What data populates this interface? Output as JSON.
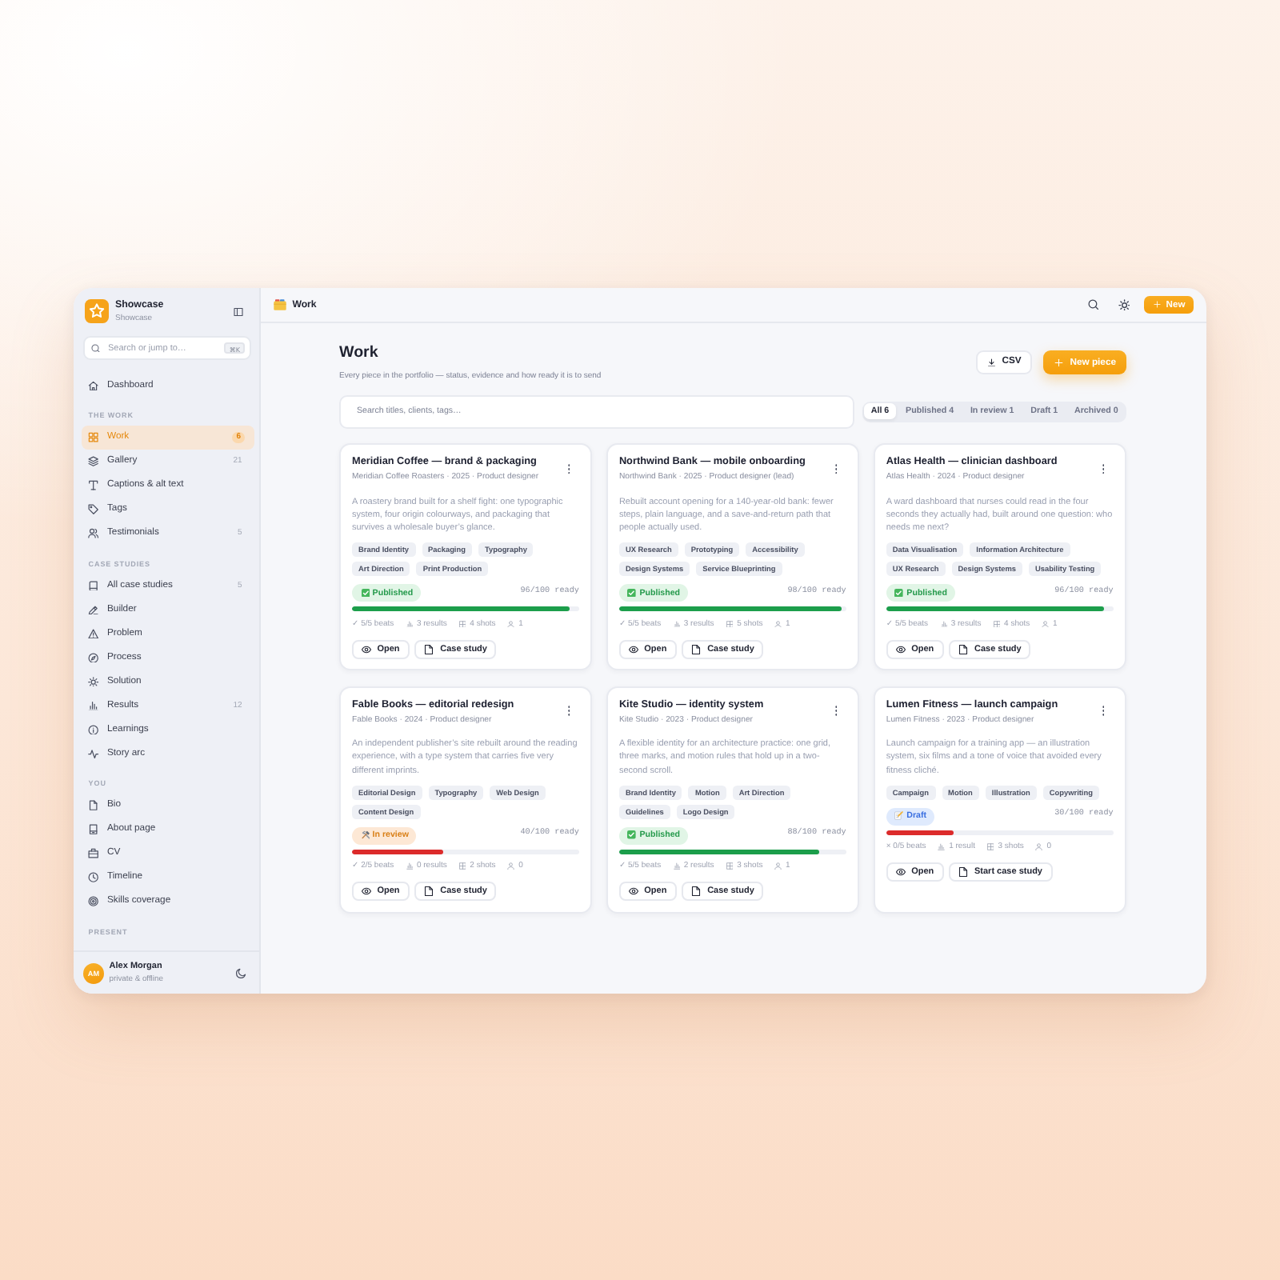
{
  "sidebar": {
    "brand": {
      "title": "Showcase",
      "subtitle": "Showcase"
    },
    "search": {
      "placeholder": "Search or jump to…",
      "shortcut": "⌘K"
    },
    "sections": [
      {
        "items": [
          {
            "label": "Dashboard",
            "selected": false
          }
        ]
      },
      {
        "heading": "THE WORK",
        "items": [
          {
            "label": "Work",
            "count": "6",
            "selected": true
          },
          {
            "label": "Gallery",
            "count": "21",
            "selected": false
          },
          {
            "label": "Captions & alt text",
            "selected": false
          },
          {
            "label": "Tags",
            "selected": false
          },
          {
            "label": "Testimonials",
            "count": "5",
            "selected": false
          }
        ]
      },
      {
        "heading": "CASE STUDIES",
        "items": [
          {
            "label": "All case studies",
            "count": "5",
            "selected": false
          },
          {
            "label": "Builder",
            "selected": false
          },
          {
            "label": "Problem",
            "selected": false
          },
          {
            "label": "Process",
            "selected": false
          },
          {
            "label": "Solution",
            "selected": false
          },
          {
            "label": "Results",
            "count": "12",
            "selected": false
          },
          {
            "label": "Learnings",
            "selected": false
          },
          {
            "label": "Story arc",
            "selected": false
          }
        ]
      },
      {
        "heading": "YOU",
        "items": [
          {
            "label": "Bio",
            "selected": false
          },
          {
            "label": "About page",
            "selected": false
          },
          {
            "label": "CV",
            "selected": false
          },
          {
            "label": "Timeline",
            "selected": false
          },
          {
            "label": "Skills coverage",
            "selected": false
          }
        ]
      },
      {
        "heading": "PRESENT"
      }
    ],
    "user": {
      "initials": "AM",
      "name": "Alex Morgan",
      "status": "private & offline"
    }
  },
  "topbar": {
    "title": "Work",
    "new_button": "New"
  },
  "header": {
    "title": "Work",
    "subtitle": "Every piece in the portfolio — status, evidence and how ready it is to send",
    "buttons": [
      {
        "label": "CSV",
        "kind": "export"
      },
      {
        "label": "New piece",
        "kind": "create"
      }
    ]
  },
  "search": {
    "placeholder": "Search titles, clients, tags…"
  },
  "filters": [
    {
      "label": "All 6",
      "selected": true
    },
    {
      "label": "Published 4",
      "selected": false
    },
    {
      "label": "In review 1",
      "selected": false
    },
    {
      "label": "Draft 1",
      "selected": false
    },
    {
      "label": "Archived 0",
      "selected": false
    }
  ],
  "cards": [
    {
      "title": "Meridian Coffee — brand & packaging",
      "meta": "Meridian Coffee Roasters · 2025 · Product designer",
      "description": "A roastery brand built for a shelf fight: one typographic system, four origin colourways, and packaging that survives a wholesale buyer’s glance.",
      "tags": [
        "Brand Identity",
        "Packaging",
        "Typography",
        "Art Direction",
        "Print Production"
      ],
      "status": {
        "label": "Published",
        "kind": "published"
      },
      "score": "96/100 ready",
      "level": 0.96,
      "stats": {
        "beats": "✓ 5/5 beats",
        "results": "3 results",
        "shots": "4 shots",
        "people": "1"
      },
      "actions": [
        {
          "label": "Open",
          "kind": "open"
        },
        {
          "label": "Case study",
          "kind": "case_study"
        }
      ]
    },
    {
      "title": "Northwind Bank — mobile onboarding",
      "meta": "Northwind Bank · 2025 · Product designer (lead)",
      "description": "Rebuilt account opening for a 140-year-old bank: fewer steps, plain language, and a save-and-return path that people actually used.",
      "tags": [
        "UX Research",
        "Prototyping",
        "Accessibility",
        "Design Systems",
        "Service Blueprinting"
      ],
      "status": {
        "label": "Published",
        "kind": "published"
      },
      "score": "98/100 ready",
      "level": 0.98,
      "stats": {
        "beats": "✓ 5/5 beats",
        "results": "3 results",
        "shots": "5 shots",
        "people": "1"
      },
      "actions": [
        {
          "label": "Open",
          "kind": "open"
        },
        {
          "label": "Case study",
          "kind": "case_study"
        }
      ]
    },
    {
      "title": "Atlas Health — clinician dashboard",
      "meta": "Atlas Health · 2024 · Product designer",
      "description": "A ward dashboard that nurses could read in the four seconds they actually had, built around one question: who needs me next?",
      "tags": [
        "Data Visualisation",
        "Information Architecture",
        "UX Research",
        "Design Systems",
        "Usability Testing"
      ],
      "status": {
        "label": "Published",
        "kind": "published"
      },
      "score": "96/100 ready",
      "level": 0.96,
      "stats": {
        "beats": "✓ 5/5 beats",
        "results": "3 results",
        "shots": "4 shots",
        "people": "1"
      },
      "actions": [
        {
          "label": "Open",
          "kind": "open"
        },
        {
          "label": "Case study",
          "kind": "case_study"
        }
      ]
    },
    {
      "title": "Fable Books — editorial redesign",
      "meta": "Fable Books · 2024 · Product designer",
      "description": "An independent publisher’s site rebuilt around the reading experience, with a type system that carries five very different imprints.",
      "tags": [
        "Editorial Design",
        "Typography",
        "Web Design",
        "Content Design"
      ],
      "status": {
        "label": "In review",
        "kind": "review"
      },
      "score": "40/100 ready",
      "level": 0.4,
      "stats": {
        "beats": "✓ 2/5 beats",
        "results": "0 results",
        "shots": "2 shots",
        "people": "0"
      },
      "actions": [
        {
          "label": "Open",
          "kind": "open"
        },
        {
          "label": "Case study",
          "kind": "case_study"
        }
      ]
    },
    {
      "title": "Kite Studio — identity system",
      "meta": "Kite Studio · 2023 · Product designer",
      "description": "A flexible identity for an architecture practice: one grid, three marks, and motion rules that hold up in a two-second scroll.",
      "tags": [
        "Brand Identity",
        "Motion",
        "Art Direction",
        "Guidelines",
        "Logo Design"
      ],
      "status": {
        "label": "Published",
        "kind": "published"
      },
      "score": "88/100 ready",
      "level": 0.88,
      "stats": {
        "beats": "✓ 5/5 beats",
        "results": "2 results",
        "shots": "3 shots",
        "people": "1"
      },
      "actions": [
        {
          "label": "Open",
          "kind": "open"
        },
        {
          "label": "Case study",
          "kind": "case_study"
        }
      ]
    },
    {
      "title": "Lumen Fitness — launch campaign",
      "meta": "Lumen Fitness · 2023 · Product designer",
      "description": "Launch campaign for a training app — an illustration system, six films and a tone of voice that avoided every fitness cliché.",
      "tags": [
        "Campaign",
        "Motion",
        "Illustration",
        "Copywriting"
      ],
      "status": {
        "label": "Draft",
        "kind": "draft"
      },
      "score": "30/100 ready",
      "level": 0.3,
      "stats": {
        "beats": "× 0/5 beats",
        "results": "1 result",
        "shots": "3 shots",
        "people": "0"
      },
      "actions": [
        {
          "label": "Open",
          "kind": "open"
        },
        {
          "label": "Start case study",
          "kind": "case_study"
        }
      ]
    }
  ]
}
